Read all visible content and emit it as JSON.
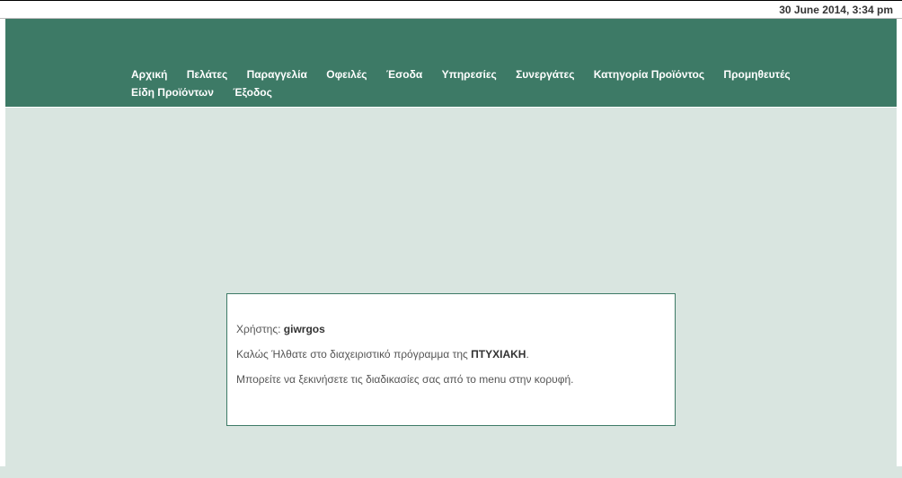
{
  "topbar": {
    "datetime": "30 June 2014, 3:34 pm"
  },
  "nav": {
    "items": [
      "Αρχική",
      "Πελάτες",
      "Παραγγελία",
      "Οφειλές",
      "Έσοδα",
      "Υπηρεσίες",
      "Συνεργάτες",
      "Κατηγορία Προϊόντος",
      "Προμηθευτές",
      "Είδη Προϊόντων",
      "Έξοδος"
    ]
  },
  "welcome": {
    "user_label": "Χρήστης: ",
    "username": "giwrgos",
    "line1_a": "Καλώς Ήλθατε στο διαχειριστικό πρόγραμμα της ",
    "line1_b": "ΠΤΥΧΙΑΚΗ",
    "line1_c": ".",
    "line2": "Μπορείτε να ξεκινήσετε τις διαδικασίες σας από το menu στην κορυφή."
  }
}
